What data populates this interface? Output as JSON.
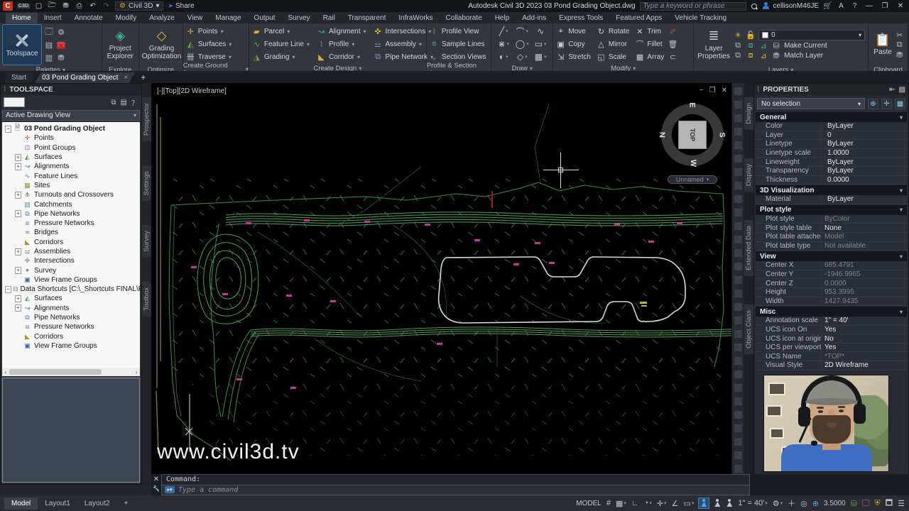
{
  "titlebar": {
    "app_letter": "C",
    "app_badge": "C3D",
    "workspace": "Civil 3D",
    "share_label": "Share",
    "title": "Autodesk Civil 3D 2023    03 Pond Grading Object.dwg",
    "search_placeholder": "Type a keyword or phrase",
    "user": "cellisonM46JE",
    "help_glyph": "?"
  },
  "ribbon_tabs": [
    {
      "label": "Home",
      "state": "active"
    },
    {
      "label": "Insert"
    },
    {
      "label": "Annotate"
    },
    {
      "label": "Modify"
    },
    {
      "label": "Analyze"
    },
    {
      "label": "View"
    },
    {
      "label": "Manage"
    },
    {
      "label": "Output"
    },
    {
      "label": "Survey"
    },
    {
      "label": "Rail"
    },
    {
      "label": "Transparent"
    },
    {
      "label": "InfraWorks"
    },
    {
      "label": "Collaborate"
    },
    {
      "label": "Help"
    },
    {
      "label": "Add-ins"
    },
    {
      "label": "Express Tools"
    },
    {
      "label": "Featured Apps"
    },
    {
      "label": "Vehicle Tracking"
    }
  ],
  "ribbon": {
    "palettes": {
      "big": "Toolspace",
      "label": "Palettes"
    },
    "explore": {
      "big": "Project Explorer",
      "label": "Explore"
    },
    "optimize": {
      "big": "Grading Optimization",
      "label": "Optimize"
    },
    "ground": {
      "label": "Create Ground Data",
      "items": [
        {
          "label": "Points",
          "ic": "✛",
          "c": "c1"
        },
        {
          "label": "Surfaces",
          "ic": "◭",
          "c": "c2"
        },
        {
          "label": "Traverse",
          "ic": "卌",
          "c": "c6"
        }
      ]
    },
    "design": {
      "label": "Create Design",
      "items": [
        {
          "label": "Parcel",
          "ic": "▰",
          "c": "c1"
        },
        {
          "label": "Feature Line",
          "ic": "∿",
          "c": "c2"
        },
        {
          "label": "Grading",
          "ic": "◮",
          "c": "c2"
        },
        {
          "label": "Alignment",
          "ic": "↝",
          "c": "c3"
        },
        {
          "label": "Profile",
          "ic": "⌇",
          "c": "c2"
        },
        {
          "label": "Corridor",
          "ic": "◣",
          "c": "c1"
        },
        {
          "label": "Intersections",
          "ic": "✜",
          "c": "c1"
        },
        {
          "label": "Assembly",
          "ic": "⚍",
          "c": "c5"
        },
        {
          "label": "Pipe Network",
          "ic": "⧉",
          "c": "c5"
        }
      ]
    },
    "psv": {
      "label": "Profile & Section Views",
      "items": [
        {
          "label": "Profile View",
          "ic": "⌇",
          "c": "c2"
        },
        {
          "label": "Sample Lines",
          "ic": "≡",
          "c": "c3"
        },
        {
          "label": "Section Views",
          "ic": "⌄",
          "c": "c2"
        }
      ]
    },
    "draw": {
      "label": "Draw"
    },
    "modify": {
      "label": "Modify",
      "items": [
        {
          "label": "Move",
          "ic": "⌖",
          "c": "c6"
        },
        {
          "label": "Copy",
          "ic": "▣",
          "c": "c6"
        },
        {
          "label": "Stretch",
          "ic": "⇲",
          "c": "c6"
        },
        {
          "label": "Rotate",
          "ic": "↻",
          "c": "c6"
        },
        {
          "label": "Mirror",
          "ic": "△",
          "c": "c6"
        },
        {
          "label": "Scale",
          "ic": "◱",
          "c": "c6"
        },
        {
          "label": "Trim",
          "ic": "✕",
          "c": "c6"
        },
        {
          "label": "Fillet",
          "ic": "⌒",
          "c": "c6"
        },
        {
          "label": "Array",
          "ic": "▦",
          "c": "c6"
        }
      ]
    },
    "layers": {
      "label": "Layers",
      "big": "Layer Properties",
      "combo_value": "0",
      "make_current": "Make Current",
      "match_layer": "Match Layer"
    },
    "clipboard": {
      "label": "Clipboard",
      "big": "Paste"
    }
  },
  "file_tabs": {
    "start": "Start",
    "doc": "03 Pond Grading Object",
    "close": "×",
    "plus": "+"
  },
  "toolspace": {
    "title": "TOOLSPACE",
    "view_combo": "Active Drawing View",
    "tree": [
      {
        "label": "03 Pond Grading Object",
        "icon": "dwg",
        "expand": "minus",
        "ind": "ind0",
        "w": "bold"
      },
      {
        "label": "Points",
        "icon": "points",
        "ind": "ind1"
      },
      {
        "label": "Point Groups",
        "icon": "pointgroups",
        "ind": "ind1"
      },
      {
        "label": "Surfaces",
        "icon": "surfaces",
        "expand": "plus",
        "ind": "ind1"
      },
      {
        "label": "Alignments",
        "icon": "alignments",
        "expand": "plus",
        "ind": "ind1"
      },
      {
        "label": "Feature Lines",
        "icon": "featurelines",
        "ind": "ind1"
      },
      {
        "label": "Sites",
        "icon": "sites",
        "ind": "ind1"
      },
      {
        "label": "Turnouts and Crossovers",
        "icon": "turnouts",
        "expand": "plus",
        "ind": "ind1"
      },
      {
        "label": "Catchments",
        "icon": "catchments",
        "ind": "ind1"
      },
      {
        "label": "Pipe Networks",
        "icon": "pipes",
        "expand": "plus",
        "ind": "ind1"
      },
      {
        "label": "Pressure Networks",
        "icon": "pressure",
        "ind": "ind1"
      },
      {
        "label": "Bridges",
        "icon": "bridges",
        "ind": "ind1"
      },
      {
        "label": "Corridors",
        "icon": "corridors",
        "ind": "ind1"
      },
      {
        "label": "Assemblies",
        "icon": "assemblies",
        "expand": "plus",
        "ind": "ind1"
      },
      {
        "label": "Intersections",
        "icon": "intersections",
        "ind": "ind1"
      },
      {
        "label": "Survey",
        "icon": "survey",
        "expand": "plus",
        "ind": "ind1"
      },
      {
        "label": "View Frame Groups",
        "icon": "vfg",
        "ind": "ind1"
      },
      {
        "label": "Data Shortcuts [C:\\_Shortcuts FINAL\\POND ...",
        "icon": "shortcuts",
        "expand": "minus",
        "ind": "ind0"
      },
      {
        "label": "Surfaces",
        "icon": "surfaces",
        "expand": "plus",
        "ind": "ind1"
      },
      {
        "label": "Alignments",
        "icon": "alignments",
        "expand": "plus",
        "ind": "ind1"
      },
      {
        "label": "Pipe Networks",
        "icon": "pipes",
        "ind": "ind1"
      },
      {
        "label": "Pressure Networks",
        "icon": "pressure",
        "ind": "ind1"
      },
      {
        "label": "Corridors",
        "icon": "corridors",
        "ind": "ind1"
      },
      {
        "label": "View Frame Groups",
        "icon": "vfg",
        "ind": "ind1"
      }
    ]
  },
  "left_tabs": [
    {
      "label": "Prospector"
    },
    {
      "label": "Settings"
    },
    {
      "label": "Survey"
    },
    {
      "label": "Toolbox"
    }
  ],
  "right_tabs": [
    {
      "label": "Design"
    },
    {
      "label": "Display"
    },
    {
      "label": "Extended Data"
    },
    {
      "label": "Object Class"
    }
  ],
  "viewport": {
    "label": "[-][Top][2D Wireframe]",
    "viewcube_top": "TOP",
    "compass": {
      "top": "E",
      "left": "N",
      "right": "S",
      "bottom": "W"
    },
    "named_view": "Unnamed",
    "watermark": "www.civil3d.tv",
    "min": "−",
    "restore": "❐",
    "close": "✕"
  },
  "properties": {
    "title": "PROPERTIES",
    "selector": "No selection",
    "sections": [
      {
        "title": "General",
        "rows": [
          {
            "label": "Color",
            "value": "ByLayer",
            "deco": "swatch"
          },
          {
            "label": "Layer",
            "value": "0"
          },
          {
            "label": "Linetype",
            "value": "ByLayer",
            "deco": "line"
          },
          {
            "label": "Linetype scale",
            "value": "1.0000"
          },
          {
            "label": "Lineweight",
            "value": "ByLayer",
            "deco": "line"
          },
          {
            "label": "Transparency",
            "value": "ByLayer"
          },
          {
            "label": "Thickness",
            "value": "0.0000"
          }
        ]
      },
      {
        "title": "3D Visualization",
        "rows": [
          {
            "label": "Material",
            "value": "ByLayer"
          }
        ]
      },
      {
        "title": "Plot style",
        "rows": [
          {
            "label": "Plot style",
            "value": "ByColor",
            "mut": "muted"
          },
          {
            "label": "Plot style table",
            "value": "None"
          },
          {
            "label": "Plot table attached...",
            "value": "Model",
            "mut": "muted"
          },
          {
            "label": "Plot table type",
            "value": "Not available",
            "mut": "muted"
          }
        ]
      },
      {
        "title": "View",
        "rows": [
          {
            "label": "Center X",
            "value": "685.4791",
            "mut": "muted"
          },
          {
            "label": "Center Y",
            "value": "-1946.9965",
            "mut": "muted"
          },
          {
            "label": "Center Z",
            "value": "0.0000",
            "mut": "muted"
          },
          {
            "label": "Height",
            "value": "953.3995",
            "mut": "muted"
          },
          {
            "label": "Width",
            "value": "1427.9435",
            "mut": "muted"
          }
        ]
      },
      {
        "title": "Misc",
        "rows": [
          {
            "label": "Annotation scale",
            "value": "1\" = 40'"
          },
          {
            "label": "UCS icon On",
            "value": "Yes"
          },
          {
            "label": "UCS icon at origin",
            "value": "No"
          },
          {
            "label": "UCS per viewport",
            "value": "Yes"
          },
          {
            "label": "UCS Name",
            "value": "*TOP*",
            "mut": "muted"
          },
          {
            "label": "Visual Style",
            "value": "2D Wireframe"
          }
        ]
      }
    ]
  },
  "command": {
    "history": "Command:",
    "placeholder": "Type a command"
  },
  "statusbar": {
    "layout_tabs": [
      {
        "label": "Model",
        "state": "active"
      },
      {
        "label": "Layout1"
      },
      {
        "label": "Layout2"
      },
      {
        "label": "+"
      }
    ],
    "model_label": "MODEL",
    "scale": "1\" = 40'",
    "lineweight_value": "3.5000"
  }
}
